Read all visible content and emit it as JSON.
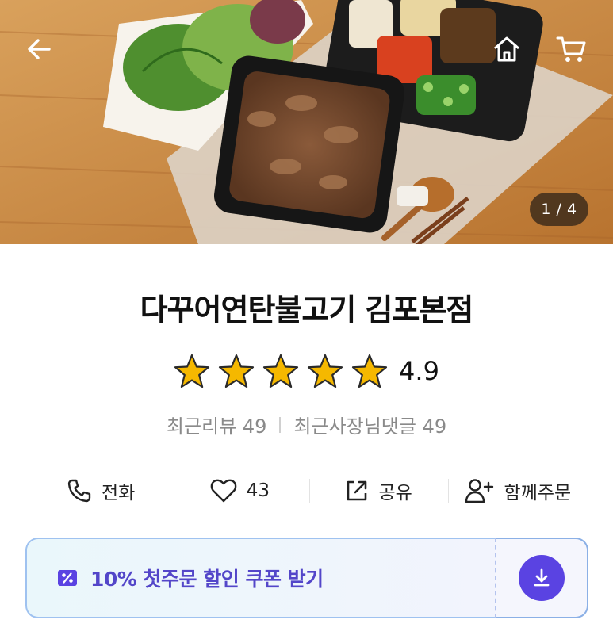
{
  "header": {
    "back_icon": "arrow-left-icon",
    "home_icon": "home-icon",
    "cart_icon": "cart-icon",
    "image_counter": "1 / 4"
  },
  "store": {
    "name": "다꾸어연탄불고기 김포본점",
    "rating": "4.9",
    "star_count": 5,
    "star_color": "#f5b800",
    "recent_reviews": "최근리뷰 49",
    "owner_replies": "최근사장님댓글 49"
  },
  "actions": [
    {
      "icon": "phone-icon",
      "label": "전화"
    },
    {
      "icon": "heart-icon",
      "label": "43"
    },
    {
      "icon": "share-icon",
      "label": "공유"
    },
    {
      "icon": "add-user-icon",
      "label": "함께주문"
    }
  ],
  "coupon": {
    "icon": "coupon-icon",
    "label": "10% 첫주문 할인 쿠폰 받기",
    "download_icon": "download-icon",
    "accent": "#5a43e2"
  }
}
